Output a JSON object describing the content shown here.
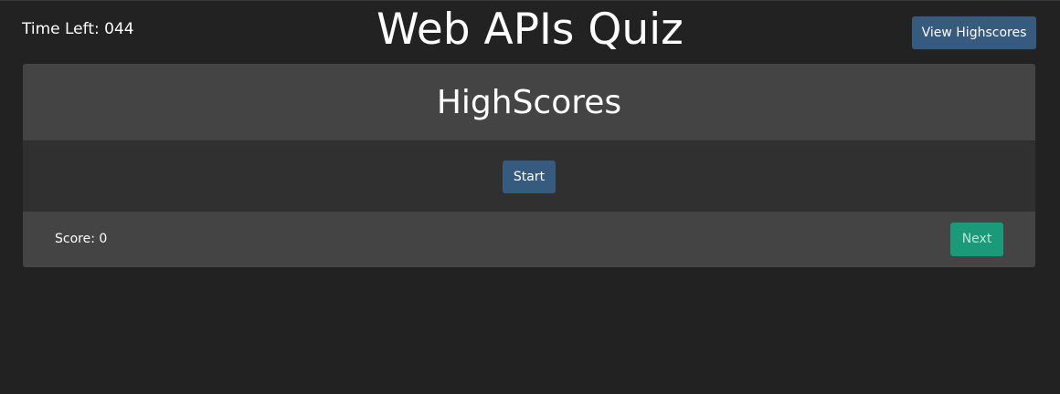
{
  "header": {
    "timer_text": "Time Left: 044",
    "title": "Web APIs Quiz",
    "view_highscores_label": "View Highscores"
  },
  "card": {
    "heading": "HighScores",
    "start_label": "Start",
    "score_text": "Score: 0",
    "next_label": "Next"
  },
  "colors": {
    "background": "#222222",
    "card_header": "#444444",
    "card_body": "#303030",
    "primary_button": "#375a7f",
    "success_button": "#1a9a78"
  }
}
